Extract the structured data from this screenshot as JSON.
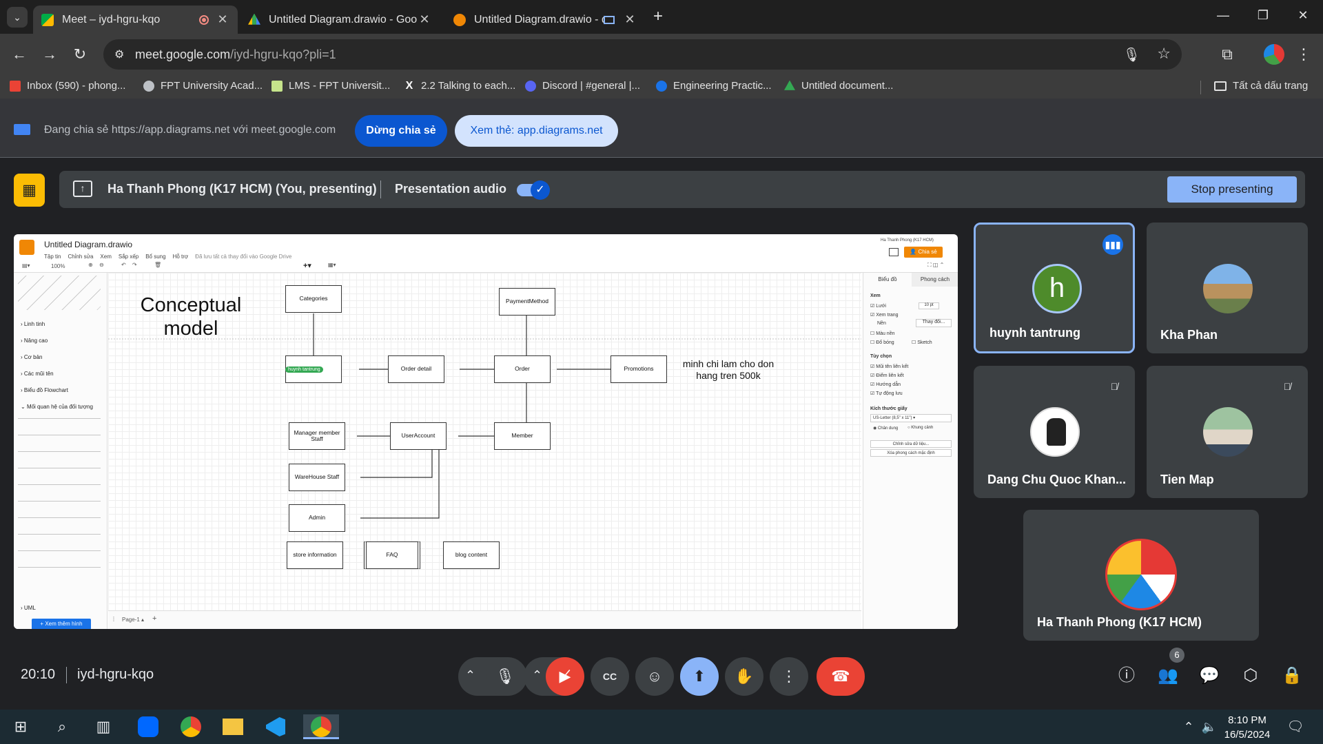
{
  "browser": {
    "tabs": [
      {
        "title": "Meet – iyd-hgru-kqo",
        "active": true,
        "recording": true
      },
      {
        "title": "Untitled Diagram.drawio - Goo",
        "active": false
      },
      {
        "title": "Untitled Diagram.drawio - d",
        "active": false
      }
    ],
    "url_host": "meet.google.com",
    "url_path": "/iyd-hgru-kqo?pli=1",
    "bookmarks": [
      {
        "label": "Inbox (590) - phong...",
        "color": "#ea4335"
      },
      {
        "label": "FPT University Acad...",
        "color": "#bdc1c6"
      },
      {
        "label": "LMS - FPT Universit...",
        "color": "#c6e48b"
      },
      {
        "label": "2.2 Talking to each...",
        "color": "#ffffff"
      },
      {
        "label": "Discord | #general |...",
        "color": "#5865f2"
      },
      {
        "label": "Engineering Practic...",
        "color": "#1a73e8"
      },
      {
        "label": "Untitled document...",
        "color": "#34a853"
      }
    ],
    "all_bookmarks": "Tất cả dấu trang"
  },
  "share_banner": {
    "text": "Đang chia sẻ https://app.diagrams.net với meet.google.com",
    "stop_label": "Dừng chia sẻ",
    "view_label": "Xem thẻ: app.diagrams.net"
  },
  "presenting": {
    "presenter": "Ha Thanh Phong (K17 HCM) (You, presenting)",
    "audio_label": "Presentation audio",
    "audio_on": true,
    "stop_label": "Stop presenting"
  },
  "drawio": {
    "title": "Untitled Diagram.drawio",
    "menu": [
      "Tập tin",
      "Chỉnh sửa",
      "Xem",
      "Sắp xếp",
      "Bổ sung",
      "Hỗ trợ"
    ],
    "saved_note": "Đã lưu tất cả thay đổi vào Google Drive",
    "user_badge": "Ha Thanh Phong (K17 HCM)",
    "share_label": "Chia sẻ",
    "zoom": "100%",
    "palette_sections": [
      "Linh tinh",
      "Nâng cao",
      "Cơ bản",
      "Các mũi tên",
      "Biểu đồ Flowchart",
      "Mối quan hệ của đối tượng",
      "UML"
    ],
    "more_shapes": "+ Xem thêm hình",
    "page_tab": "Page-1",
    "right_tabs": [
      "Biểu đồ",
      "Phong cách"
    ],
    "view_heading": "Xem",
    "view_options": [
      "Lưới",
      "Xem trang",
      "Nền"
    ],
    "grid_size": "10 pt",
    "change_btn": "Thay đổi...",
    "bg_options": [
      "Màu nền",
      "Đổ bóng",
      "Sketch"
    ],
    "options_heading": "Tùy chọn",
    "options": [
      "Mũi tên liên kết",
      "Điểm liên kết",
      "Hướng dẫn",
      "Tự động lưu"
    ],
    "paper_heading": "Kích thước giấy",
    "paper_size": "US-Letter (8,5\" x 11\")",
    "orientation": [
      "Chân dung",
      "Khung cảnh"
    ],
    "edit_data_btn": "Chỉnh sửa dữ liệu...",
    "clear_style_btn": "Xóa phong cách mặc định",
    "heading_line1": "Conceptual",
    "heading_line2": "model",
    "note_line1": "minh chi lam cho don",
    "note_line2": "hang tren 500k",
    "cursor_label": "huynh tantrung",
    "nodes": {
      "categories": "Categories",
      "payment": "PaymentMethod",
      "order_detail": "Order detail",
      "order": "Order",
      "promotions": "Promotions",
      "manager": "Manager member Staff",
      "useraccount": "UserAccount",
      "member": "Member",
      "warehouse": "WareHouse Staff",
      "admin": "Admin",
      "store": "store information",
      "faq": "FAQ",
      "blog": "blog content"
    }
  },
  "participants": [
    {
      "name": "huynh tantrung",
      "initial": "h",
      "speaking": true,
      "avatar_color": "#4e8b2b"
    },
    {
      "name": "Kha Phan",
      "muted": false
    },
    {
      "name": "Dang Chu Quoc Khan...",
      "muted": true
    },
    {
      "name": "Tien Map",
      "muted": true
    },
    {
      "name": "Ha Thanh Phong (K17 HCM)",
      "muted": false
    }
  ],
  "meeting": {
    "time": "20:10",
    "code": "iyd-hgru-kqo",
    "participant_count": "6"
  },
  "taskbar": {
    "time": "8:10 PM",
    "date": "16/5/2024"
  }
}
